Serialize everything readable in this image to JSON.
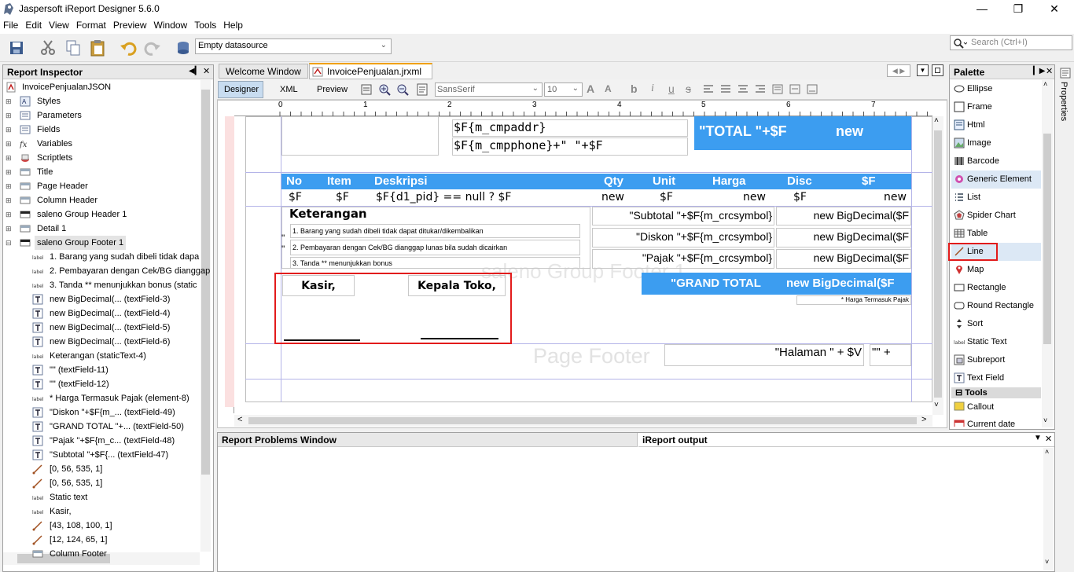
{
  "window": {
    "title": "Jaspersoft iReport Designer 5.6.0"
  },
  "menu": [
    "File",
    "Edit",
    "View",
    "Format",
    "Preview",
    "Window",
    "Tools",
    "Help"
  ],
  "toolbar": {
    "datasource": "Empty datasource",
    "search_placeholder": "Search (Ctrl+I)"
  },
  "inspector": {
    "title": "Report Inspector",
    "root": "InvoicePenjualanJSON",
    "items": [
      "Styles",
      "Parameters",
      "Fields",
      "Variables",
      "Scriptlets",
      "Title",
      "Page Header",
      "Column Header",
      "saleno Group Header 1",
      "Detail 1",
      "saleno Group Footer 1",
      "1. Barang yang sudah dibeli tidak dapa",
      "2. Pembayaran dengan Cek/BG dianggap",
      "3. Tanda ** menunjukkan bonus (static",
      "new BigDecimal(... (textField-3)",
      "new BigDecimal(... (textField-4)",
      "new BigDecimal(... (textField-5)",
      "new BigDecimal(... (textField-6)",
      "Keterangan  (staticText-4)",
      "\"\" (textField-11)",
      "\"\" (textField-12)",
      "* Harga Termasuk Pajak (element-8)",
      "\"Diskon \"+$F{m_... (textField-49)",
      "\"GRAND TOTAL \"+... (textField-50)",
      "\"Pajak \"+$F{m_c... (textField-48)",
      "\"Subtotal \"+$F{... (textField-47)",
      "[0, 56, 535, 1]",
      "[0, 56, 535, 1]",
      "Static text",
      "Kasir,",
      "[43, 108, 100, 1]",
      "[12, 124, 65, 1]",
      "Column Footer"
    ]
  },
  "tabs": {
    "welcome": "Welcome Window",
    "active": "InvoicePenjualan.jrxml"
  },
  "designer_tabs": {
    "designer": "Designer",
    "xml": "XML",
    "preview": "Preview",
    "font": "SansSerif",
    "size": "10"
  },
  "ruler": [
    "0",
    "1",
    "2",
    "3",
    "4",
    "5",
    "6",
    "7"
  ],
  "report": {
    "cmpaddr": "$F{m_cmpaddr}",
    "cmpphone": "$F{m_cmpphone}+\" \"+$F",
    "total": "\"TOTAL \"+$F",
    "total_new": "new",
    "col_no": "No",
    "col_item": "Item",
    "col_desc": "Deskripsi",
    "col_qty": "Qty",
    "col_unit": "Unit",
    "col_harga": "Harga",
    "col_disc": "Disc",
    "col_f": "$F",
    "d_no": "$F",
    "d_item": "$F",
    "d_desc": "$F{d1_pid} == null ? $F",
    "d_qty": "new",
    "d_unit": "$F",
    "d_harga": "new",
    "d_disc": "$F",
    "d_f": "new",
    "keterangan": "Keterangan",
    "note1": "1. Barang yang sudah dibeli tidak dapat ditukar/dikembalikan",
    "note2": "2. Pembayaran dengan Cek/BG dianggap lunas bila sudah dicairkan",
    "note3": "3. Tanda ** menunjukkan bonus",
    "subtotal": "\"Subtotal \"+$F{m_crcsymbol}",
    "diskon": "\"Diskon \"+$F{m_crcsymbol}",
    "pajak": "\"Pajak \"+$F{m_crcsymbol}",
    "bigdec": "new BigDecimal($F",
    "grand": "\"GRAND TOTAL",
    "grand_val": "new BigDecimal($F",
    "kasir": "Kasir,",
    "kepala": "Kepala Toko,",
    "harga_pajak": "* Harga Termasuk Pajak",
    "band_group_footer": "saleno Group Footer 1",
    "band_page_footer": "Page Footer",
    "halaman": "\"Halaman \" + $V",
    "halaman2": "\"\" +",
    "quote1": "\"",
    "quote2": "\""
  },
  "bottom": {
    "problems": "Report Problems Window",
    "output": "iReport output"
  },
  "palette": {
    "title": "Palette",
    "items": [
      "Ellipse",
      "Frame",
      "Html",
      "Image",
      "Barcode",
      "Generic Element",
      "List",
      "Spider Chart",
      "Table",
      "Line",
      "Map",
      "Rectangle",
      "Round Rectangle",
      "Sort",
      "Static Text",
      "Subreport",
      "Text Field"
    ],
    "tools_header": "Tools",
    "tools": [
      "Callout",
      "Current date"
    ],
    "selected": "Line"
  },
  "side_tab": "Properties",
  "colors": {
    "band_blue": "#3c9df0",
    "highlight_red": "#e21b1b"
  }
}
